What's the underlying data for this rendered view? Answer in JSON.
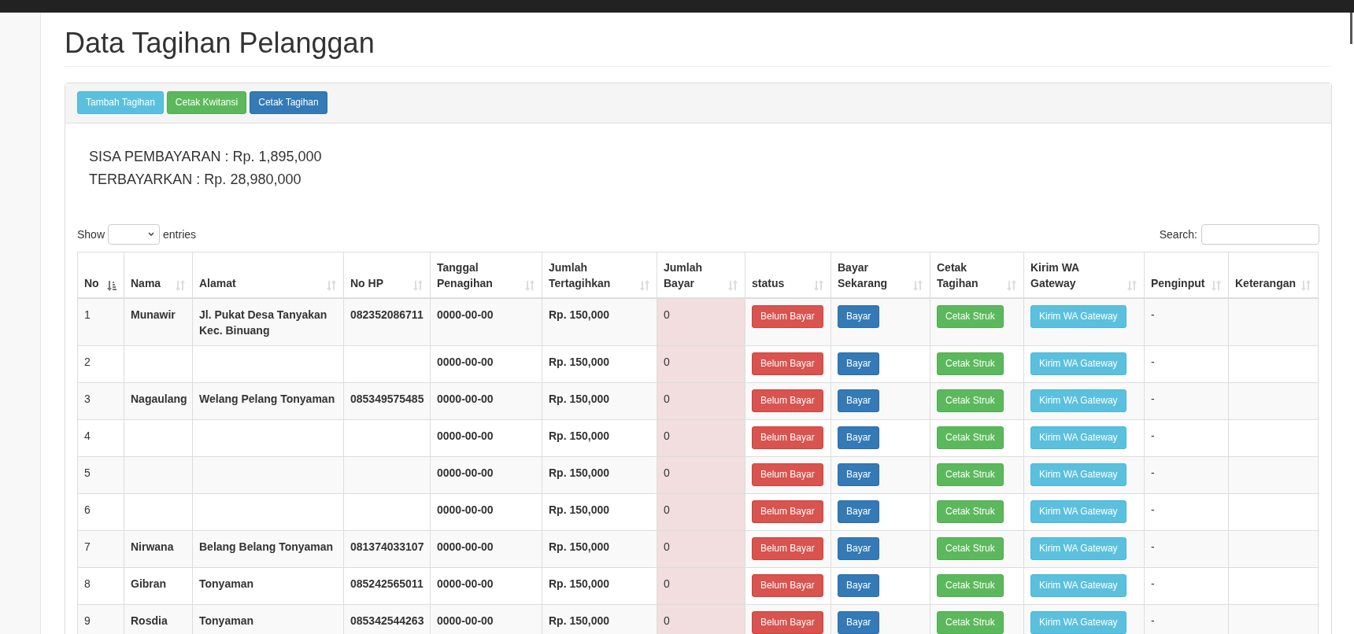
{
  "page_title": "Data Tagihan Pelanggan",
  "toolbar": [
    {
      "label": "Tambah Tagihan",
      "kind": "info"
    },
    {
      "label": "Cetak Kwitansi",
      "kind": "success"
    },
    {
      "label": "Cetak Tagihan",
      "kind": "primary"
    }
  ],
  "summary": [
    "SISA PEMBAYARAN : Rp. 1,895,000",
    "TERBAYARKAN : Rp. 28,980,000"
  ],
  "length_control": {
    "before": "Show",
    "after": "entries"
  },
  "search": {
    "label": "Search:"
  },
  "table": {
    "columns": [
      {
        "label": "No",
        "sorted": true
      },
      {
        "label": "Nama",
        "sorted": false
      },
      {
        "label": "Alamat",
        "sorted": false
      },
      {
        "label": "No HP",
        "sorted": false
      },
      {
        "label": "Tanggal Penagihan",
        "sorted": false
      },
      {
        "label": "Jumlah Tertagihkan",
        "sorted": false
      },
      {
        "label": "Jumlah Bayar",
        "sorted": false
      },
      {
        "label": "status",
        "sorted": false
      },
      {
        "label": "Bayar Sekarang",
        "sorted": false
      },
      {
        "label": "Cetak Tagihan",
        "sorted": false
      },
      {
        "label": "Kirim WA Gateway",
        "sorted": false
      },
      {
        "label": "Penginput",
        "sorted": false
      },
      {
        "label": "Keterangan",
        "sorted": false
      }
    ],
    "rows": [
      {
        "no": "1",
        "nama": "Munawir",
        "alamat": "Jl. Pukat Desa Tanyakan Kec. Binuang",
        "hp": "082352086711",
        "tanggal": "0000-00-00",
        "tertagihkan": "Rp. 150,000",
        "bayar": "0",
        "status": "Belum Bayar",
        "pay": "Bayar",
        "print": "Cetak Struk",
        "wa": "Kirim WA Gateway",
        "penginput": "-"
      },
      {
        "no": "2",
        "nama": "",
        "alamat": "",
        "hp": "",
        "tanggal": "0000-00-00",
        "tertagihkan": "Rp. 150,000",
        "bayar": "0",
        "status": "Belum Bayar",
        "pay": "Bayar",
        "print": "Cetak Struk",
        "wa": "Kirim WA Gateway",
        "penginput": "-"
      },
      {
        "no": "3",
        "nama": "Nagaulang",
        "alamat": "Welang Pelang Tonyaman",
        "hp": "085349575485",
        "tanggal": "0000-00-00",
        "tertagihkan": "Rp. 150,000",
        "bayar": "0",
        "status": "Belum Bayar",
        "pay": "Bayar",
        "print": "Cetak Struk",
        "wa": "Kirim WA Gateway",
        "penginput": "-"
      },
      {
        "no": "4",
        "nama": "",
        "alamat": "",
        "hp": "",
        "tanggal": "0000-00-00",
        "tertagihkan": "Rp. 150,000",
        "bayar": "0",
        "status": "Belum Bayar",
        "pay": "Bayar",
        "print": "Cetak Struk",
        "wa": "Kirim WA Gateway",
        "penginput": "-"
      },
      {
        "no": "5",
        "nama": "",
        "alamat": "",
        "hp": "",
        "tanggal": "0000-00-00",
        "tertagihkan": "Rp. 150,000",
        "bayar": "0",
        "status": "Belum Bayar",
        "pay": "Bayar",
        "print": "Cetak Struk",
        "wa": "Kirim WA Gateway",
        "penginput": "-"
      },
      {
        "no": "6",
        "nama": "",
        "alamat": "",
        "hp": "",
        "tanggal": "0000-00-00",
        "tertagihkan": "Rp. 150,000",
        "bayar": "0",
        "status": "Belum Bayar",
        "pay": "Bayar",
        "print": "Cetak Struk",
        "wa": "Kirim WA Gateway",
        "penginput": "-"
      },
      {
        "no": "7",
        "nama": "Nirwana",
        "alamat": "Belang Belang Tonyaman",
        "hp": "081374033107",
        "tanggal": "0000-00-00",
        "tertagihkan": "Rp. 150,000",
        "bayar": "0",
        "status": "Belum Bayar",
        "pay": "Bayar",
        "print": "Cetak Struk",
        "wa": "Kirim WA Gateway",
        "penginput": "-"
      },
      {
        "no": "8",
        "nama": "Gibran",
        "alamat": "Tonyaman",
        "hp": "085242565011",
        "tanggal": "0000-00-00",
        "tertagihkan": "Rp. 150,000",
        "bayar": "0",
        "status": "Belum Bayar",
        "pay": "Bayar",
        "print": "Cetak Struk",
        "wa": "Kirim WA Gateway",
        "penginput": "-"
      },
      {
        "no": "9",
        "nama": "Rosdia",
        "alamat": "Tonyaman",
        "hp": "085342544263",
        "tanggal": "0000-00-00",
        "tertagihkan": "Rp. 150,000",
        "bayar": "0",
        "status": "Belum Bayar",
        "pay": "Bayar",
        "print": "Cetak Struk",
        "wa": "Kirim WA Gateway",
        "penginput": "-"
      }
    ]
  }
}
